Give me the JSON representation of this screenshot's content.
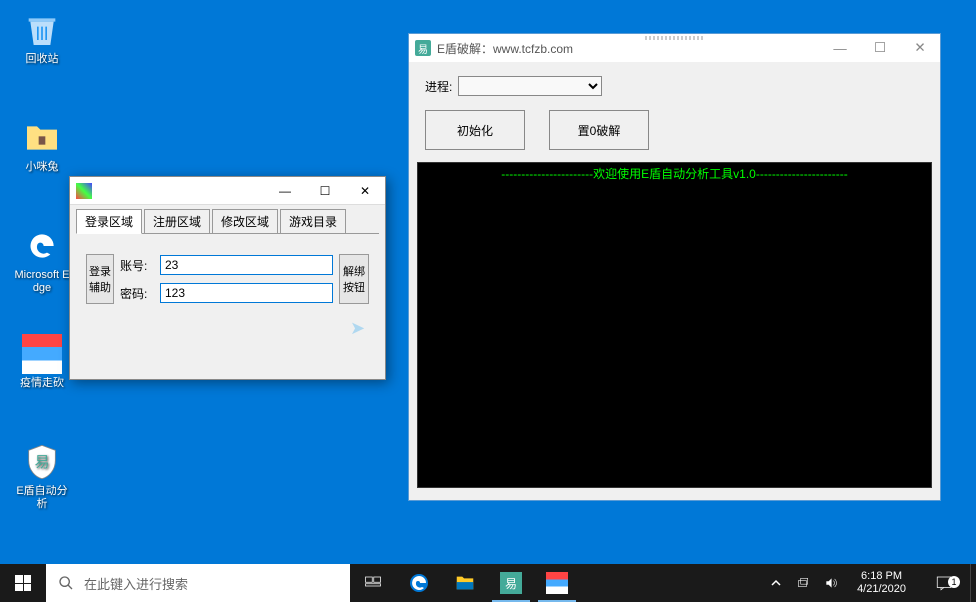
{
  "desktop": {
    "icons": [
      {
        "label": "回收站"
      },
      {
        "label": "小咪兔"
      },
      {
        "label": "Microsoft Edge"
      },
      {
        "label": "疫情走砍"
      },
      {
        "label": "E盾自动分析"
      }
    ]
  },
  "window1": {
    "tabs": [
      "登录区域",
      "注册区域",
      "修改区域",
      "游戏目录"
    ],
    "login_helper_btn": "登录辅助",
    "account_label": "账号:",
    "account_value": "23",
    "password_label": "密码:",
    "password_value": "123",
    "unbind_btn": "解绑按钮"
  },
  "window2": {
    "title": "E盾破解：www.tcfzb.com",
    "process_label": "进程:",
    "init_btn": "初始化",
    "crack_btn": "置0破解",
    "console_welcome": "-----------------------欢迎使用E盾自动分析工具v1.0-----------------------"
  },
  "taskbar": {
    "search_placeholder": "在此键入进行搜索",
    "time": "6:18 PM",
    "date": "4/21/2020",
    "notif_count": "1"
  }
}
